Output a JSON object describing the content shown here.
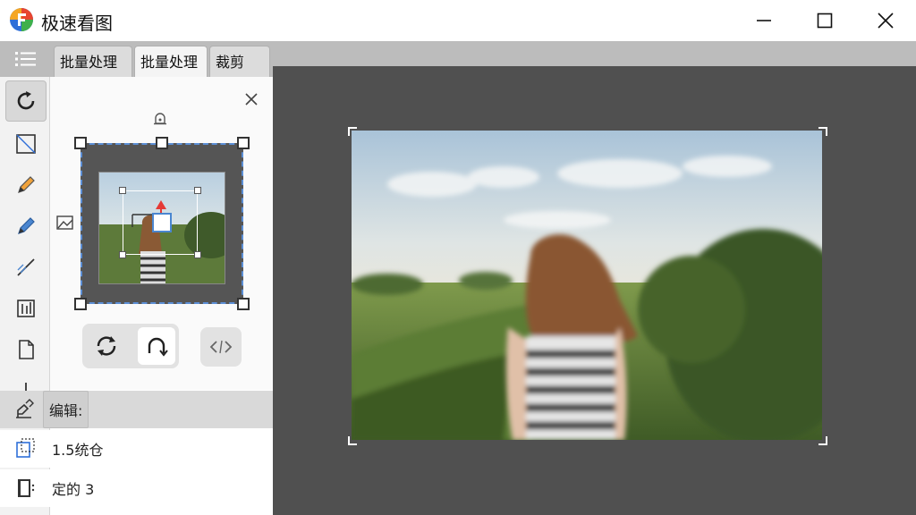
{
  "window": {
    "title": "极速看图",
    "logo_colors": [
      "#e8452f",
      "#f5a623",
      "#2f6fd8",
      "#3fb04a"
    ]
  },
  "tabs": [
    {
      "label": "批量处理",
      "active": false
    },
    {
      "label": "批量处理",
      "active": true
    },
    {
      "label": "裁剪",
      "active": false
    }
  ],
  "tools": [
    {
      "icon": "rotate-icon",
      "selected": true
    },
    {
      "icon": "crop-frame-icon",
      "selected": false
    },
    {
      "icon": "pencil-icon",
      "selected": false
    },
    {
      "icon": "brush-icon",
      "selected": false
    },
    {
      "icon": "line-icon",
      "selected": false
    },
    {
      "icon": "adjust-icon",
      "selected": false
    },
    {
      "icon": "document-icon",
      "selected": false
    },
    {
      "icon": "arrow-down-icon",
      "selected": false
    }
  ],
  "sidebar": {
    "rows": [
      {
        "icon": "edit-icon",
        "label": "编辑:"
      },
      {
        "icon": "zoom-select-icon",
        "label": "1.5统仓"
      },
      {
        "icon": "book-icon",
        "label": "定的 3"
      }
    ]
  },
  "colors": {
    "accent": "#4a86d0",
    "canvas_bg": "#505050",
    "marker": "#e53935"
  }
}
